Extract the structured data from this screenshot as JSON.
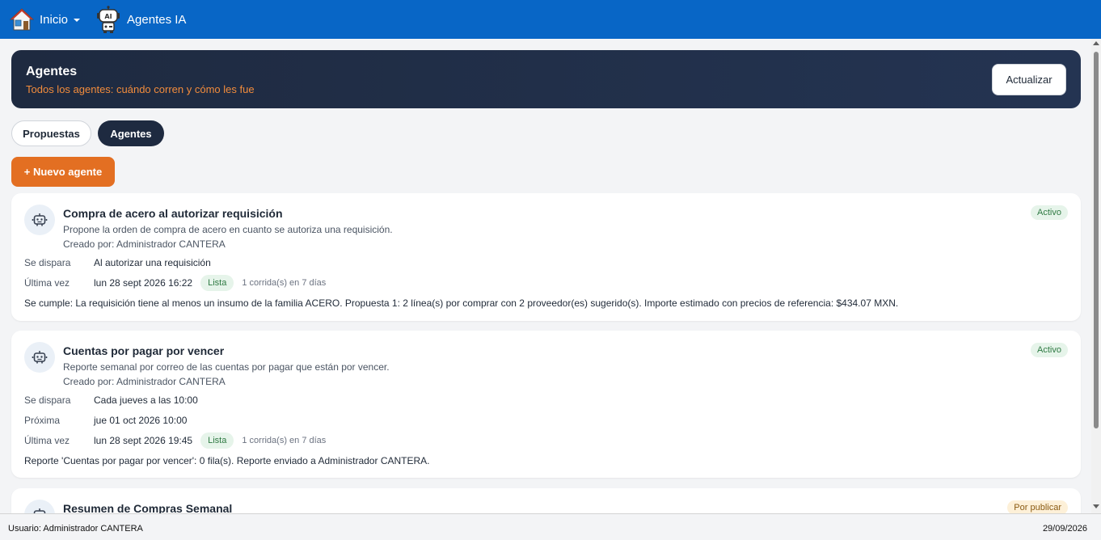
{
  "nav": {
    "home_label": "Inicio",
    "agents_label": "Agentes IA",
    "agents_icon_text": "AI"
  },
  "header": {
    "title": "Agentes",
    "subtitle": "Todos los agentes: cuándo corren y cómo les fue",
    "refresh_label": "Actualizar"
  },
  "tabs": [
    {
      "label": "Propuestas",
      "active": false
    },
    {
      "label": "Agentes",
      "active": true
    }
  ],
  "new_agent_label": "+ Nuevo agente",
  "agents": [
    {
      "name": "Compra de acero al autorizar requisición",
      "description": "Propone la orden de compra de acero en cuanto se autoriza una requisición.",
      "creator": "Creado por: Administrador CANTERA",
      "status": "Activo",
      "trigger_label": "Se dispara",
      "trigger": "Al autorizar una requisición",
      "last_label": "Última vez",
      "last_run": "lun 28 sept 2026 16:22",
      "last_status": "Lista",
      "runs": "1 corrida(s) en 7 días",
      "result": "Se cumple: La requisición tiene al menos un insumo de la familia ACERO. Propuesta 1: 2 línea(s) por comprar con 2 proveedor(es) sugerido(s). Importe estimado con precios de referencia: $434.07 MXN."
    },
    {
      "name": "Cuentas por pagar por vencer",
      "description": "Reporte semanal por correo de las cuentas por pagar que están por vencer.",
      "creator": "Creado por: Administrador CANTERA",
      "status": "Activo",
      "trigger_label": "Se dispara",
      "trigger": "Cada jueves a las 10:00",
      "next_label": "Próxima",
      "next_run": "jue 01 oct 2026 10:00",
      "last_label": "Última vez",
      "last_run": "lun 28 sept 2026 19:45",
      "last_status": "Lista",
      "runs": "1 corrida(s) en 7 días",
      "result": "Reporte 'Cuentas por pagar por vencer': 0 fila(s). Reporte enviado a Administrador CANTERA."
    },
    {
      "name": "Resumen de Compras Semanal",
      "status": "Por publicar"
    }
  ],
  "statusbar": {
    "user": "Usuario: Administrador CANTERA",
    "date": "29/09/2026"
  },
  "colors": {
    "topbar": "#0866c6",
    "header_bg": "#1e2a40",
    "accent_orange": "#e36f22",
    "subtitle_orange": "#f28c3c",
    "active_green": "#2f7a43",
    "pending_amber": "#8a5a12"
  }
}
